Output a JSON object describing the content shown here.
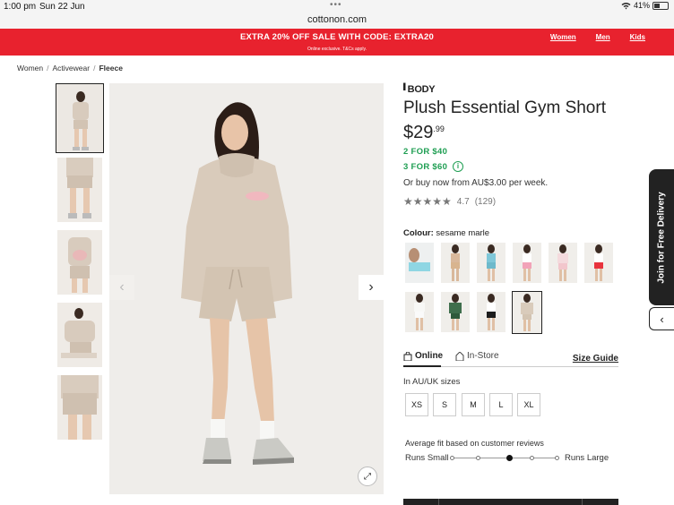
{
  "status": {
    "time": "1:00 pm",
    "date": "Sun 22 Jun",
    "battery": "41%"
  },
  "browser": {
    "url": "cottonon.com"
  },
  "promo": {
    "headline": "EXTRA 20% OFF SALE WITH CODE: EXTRA20",
    "fineprint": "Online exclusive. T&Cs apply.",
    "nav": [
      "Women",
      "Men",
      "Kids"
    ],
    "color": "#e8222e"
  },
  "breadcrumb": [
    "Women",
    "Activewear",
    "Fleece"
  ],
  "gallery": {
    "thumbnail_count": 5,
    "active_index": 0
  },
  "product": {
    "brand": "BODY",
    "title": "Plush Essential Gym Short",
    "price_dollars": "$29",
    "price_cents": ".99",
    "deals": [
      "2 FOR $40",
      "3 FOR $60"
    ],
    "afterpay": "Or buy now from AU$3.00 per week.",
    "rating_stars": "★★★★★",
    "rating_value": "4.7",
    "rating_count": "(129)",
    "colour_label": "Colour:",
    "colour_value": "sesame marle",
    "swatch_count": 10,
    "selected_swatch": 9
  },
  "tabs": {
    "online": "Online",
    "instore": "In-Store",
    "size_guide": "Size Guide"
  },
  "sizes": {
    "label": "In AU/UK sizes",
    "options": [
      "XS",
      "S",
      "M",
      "L",
      "XL"
    ]
  },
  "fit": {
    "label": "Average fit based on customer reviews",
    "small": "Runs Small",
    "large": "Runs Large",
    "selected_step": 3,
    "steps": 5
  },
  "side_tab": {
    "label": "Join for Free Delivery"
  },
  "icons": {
    "prev": "chevron-left-icon",
    "next": "chevron-right-icon",
    "expand": "expand-icon",
    "info": "info-icon",
    "collapse": "chevron-left-icon"
  },
  "colors": {
    "deal_green": "#1e9e52",
    "brand_red": "#e8222e"
  }
}
